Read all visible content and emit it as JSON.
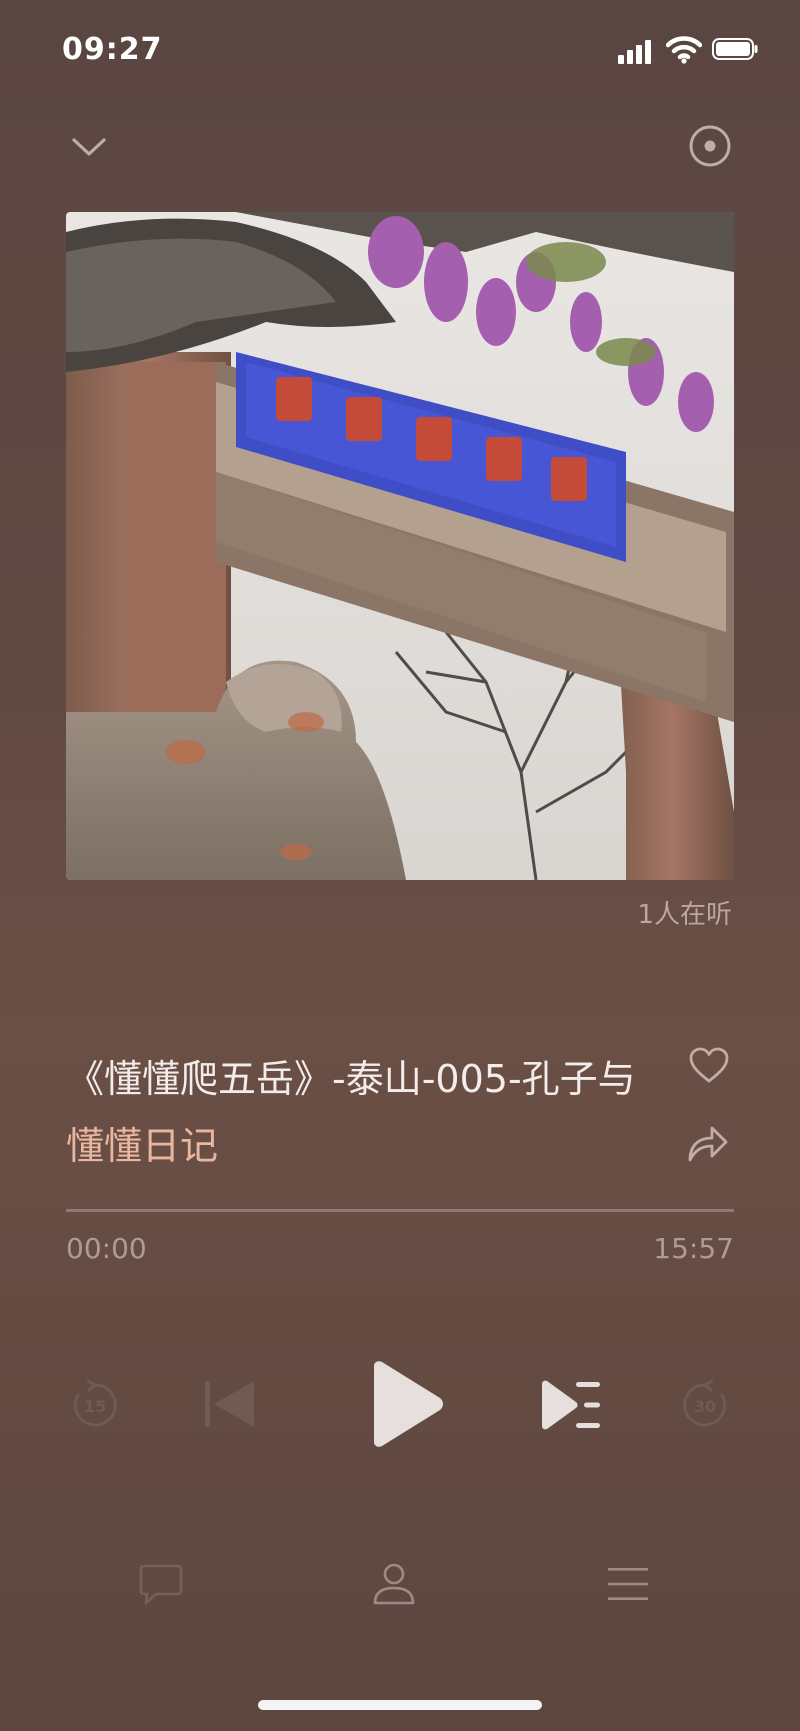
{
  "status_bar": {
    "time": "09:27"
  },
  "player": {
    "listeners": "1人在听",
    "track_title": "《懂懂爬五岳》-泰山-005-孔子与",
    "album": "懂懂日记",
    "elapsed": "00:00",
    "duration": "15:57",
    "progress": 0
  },
  "controls": {
    "rewind_seconds": "15",
    "forward_seconds": "30"
  },
  "colors": {
    "background": "#5f4842",
    "album_accent": "#e9b79f",
    "muted_text": "#ad9b95"
  },
  "icons": {
    "collapse": "chevron-down-icon",
    "cast": "cast-icon",
    "favorite": "heart-icon",
    "share": "share-icon",
    "rewind": "rewind-15-icon",
    "previous": "previous-icon",
    "play": "play-icon",
    "play_next": "play-queue-icon",
    "forward": "forward-30-icon",
    "comments": "comment-icon",
    "profile": "person-icon",
    "playlist": "menu-icon"
  }
}
